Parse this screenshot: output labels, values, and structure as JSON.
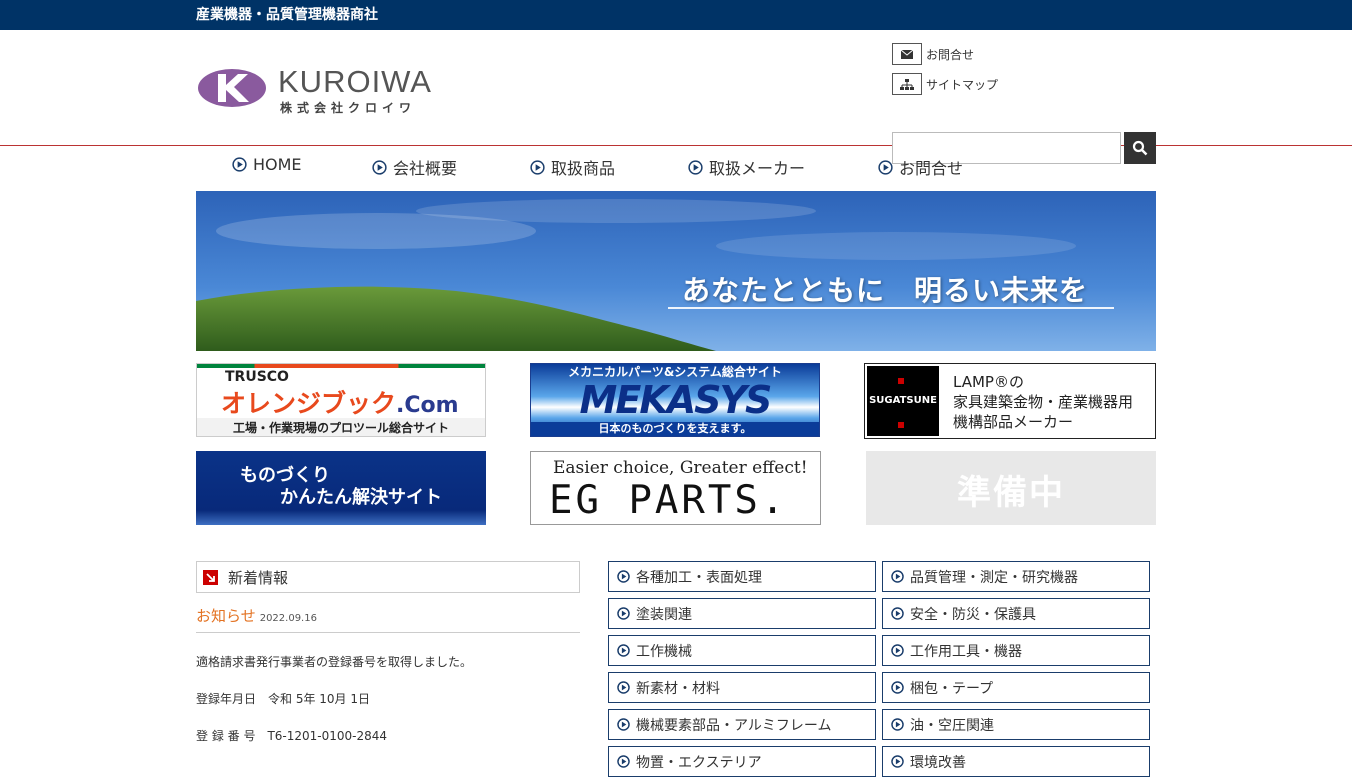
{
  "topbar": {
    "tagline": "産業機器・品質管理機器商社"
  },
  "logo": {
    "name": "KUROIWA",
    "sub": "株式会社クロイワ",
    "brand_color": "#8a5a9e"
  },
  "header_links": [
    {
      "label": "お問合せ",
      "icon": "envelope-icon"
    },
    {
      "label": "サイトマップ",
      "icon": "sitemap-icon"
    }
  ],
  "search": {
    "placeholder": "",
    "button_icon": "search-icon"
  },
  "nav": [
    {
      "label": "HOME"
    },
    {
      "label": "会社概要"
    },
    {
      "label": "取扱商品"
    },
    {
      "label": "取扱メーカー"
    },
    {
      "label": "お問合せ"
    }
  ],
  "hero": {
    "text": "あなたとともに　明るい未来を"
  },
  "banners": {
    "trusco": {
      "brand": "TRUSCO",
      "title": "オレンジブック",
      "suffix": ".Com",
      "caption": "工場・作業現場のプロツール総合サイト"
    },
    "mekasys": {
      "top": "メカニカルパーツ&システム総合サイト",
      "logo": "MEKASYS",
      "bottom": "日本のものづくりを支えます。"
    },
    "sugatsune": {
      "logo": "SUGATSUNE",
      "line1": "LAMP®の",
      "line2": "家具建築金物・産業機器用",
      "line3": "機構部品メーカー"
    },
    "monozukuri": {
      "line1": "ものづくり",
      "line2": "かんたん解決サイト"
    },
    "egparts": {
      "tagline": "Easier choice, Greater effect!",
      "logo": "EG PARTS."
    },
    "preparing": {
      "text": "準備中"
    }
  },
  "news": {
    "heading": "新着情報",
    "item_title": "お知らせ",
    "item_date": "2022.09.16",
    "body1": "適格請求書発行事業者の登録番号を取得しました。",
    "body2": "登録年月日　令和 5年 10月 1日",
    "body3": "登 録 番 号　T6-1201-0100-2844"
  },
  "categories": [
    {
      "label": "各種加工・表面処理"
    },
    {
      "label": "品質管理・測定・研究機器"
    },
    {
      "label": "塗装関連"
    },
    {
      "label": "安全・防災・保護具"
    },
    {
      "label": "工作機械"
    },
    {
      "label": "工作用工具・機器"
    },
    {
      "label": "新素材・材料"
    },
    {
      "label": "梱包・テープ"
    },
    {
      "label": "機械要素部品・アルミフレーム"
    },
    {
      "label": "油・空圧関連"
    },
    {
      "label": "物置・エクステリア"
    },
    {
      "label": "環境改善"
    }
  ]
}
